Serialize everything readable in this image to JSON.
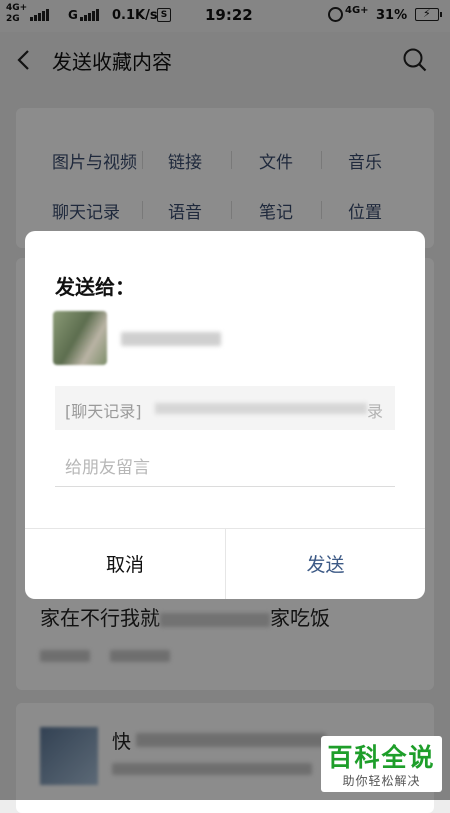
{
  "status_bar": {
    "net_top": "4G+",
    "net_bottom": "2G",
    "net_g": "G",
    "speed": "0.1K/s",
    "sim_badge": "S",
    "time": "19:22",
    "net_right": "4G+",
    "battery_percent": "31%"
  },
  "header": {
    "title": "发送收藏内容"
  },
  "filters": [
    {
      "label": "图片与视频"
    },
    {
      "label": "链接"
    },
    {
      "label": "文件"
    },
    {
      "label": "音乐"
    },
    {
      "label": "聊天记录"
    },
    {
      "label": "语音"
    },
    {
      "label": "笔记"
    },
    {
      "label": "位置"
    }
  ],
  "favorites": [
    {
      "title_visible": "家在不行我就",
      "title_tail": "家吃饭"
    },
    {
      "title_visible": "快"
    }
  ],
  "dialog": {
    "title": "发送给：",
    "preview_label": "[聊天记录]",
    "preview_tail": "录",
    "message_placeholder": "给朋友留言",
    "cancel_label": "取消",
    "send_label": "发送"
  },
  "watermark": {
    "main": "百科全说",
    "sub": "助你轻松解决"
  },
  "colors": {
    "accent": "#3d5a86",
    "filter_text": "#3a4c6e",
    "watermark_green": "#1e9e2a"
  }
}
